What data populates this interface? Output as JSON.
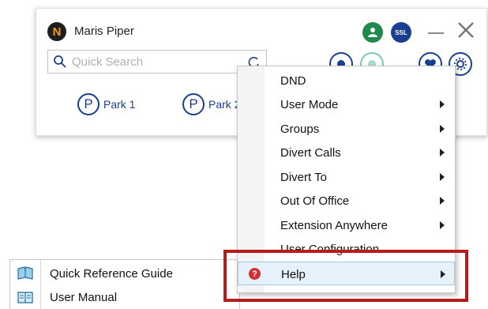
{
  "window": {
    "logo_letter": "N",
    "user_name": "Maris Piper",
    "ssl_badge": "SSL",
    "search": {
      "placeholder": "Quick Search",
      "value": ""
    }
  },
  "parks": [
    {
      "letter": "P",
      "label": "Park 1"
    },
    {
      "letter": "P",
      "label": "Park 2"
    }
  ],
  "context_menu": {
    "items": [
      {
        "label": "DND",
        "has_submenu": false
      },
      {
        "label": "User Mode",
        "has_submenu": true
      },
      {
        "label": "Groups",
        "has_submenu": true
      },
      {
        "label": "Divert Calls",
        "has_submenu": true
      },
      {
        "label": "Divert To",
        "has_submenu": true
      },
      {
        "label": "Out Of Office",
        "has_submenu": true
      },
      {
        "label": "Extension Anywhere",
        "has_submenu": true
      },
      {
        "label": "User Configuration",
        "has_submenu": false
      },
      {
        "label": "Help",
        "has_submenu": true,
        "selected": true,
        "icon": "help-icon"
      }
    ]
  },
  "help_submenu": {
    "items": [
      {
        "label": "Quick Reference Guide",
        "icon": "book-open-icon"
      },
      {
        "label": "User Manual",
        "icon": "manual-icon"
      }
    ]
  },
  "colors": {
    "brand_blue": "#1b3f8f",
    "user_green": "#1f8a4c",
    "highlight_red": "#b71c1c",
    "help_red": "#d32f2f"
  }
}
